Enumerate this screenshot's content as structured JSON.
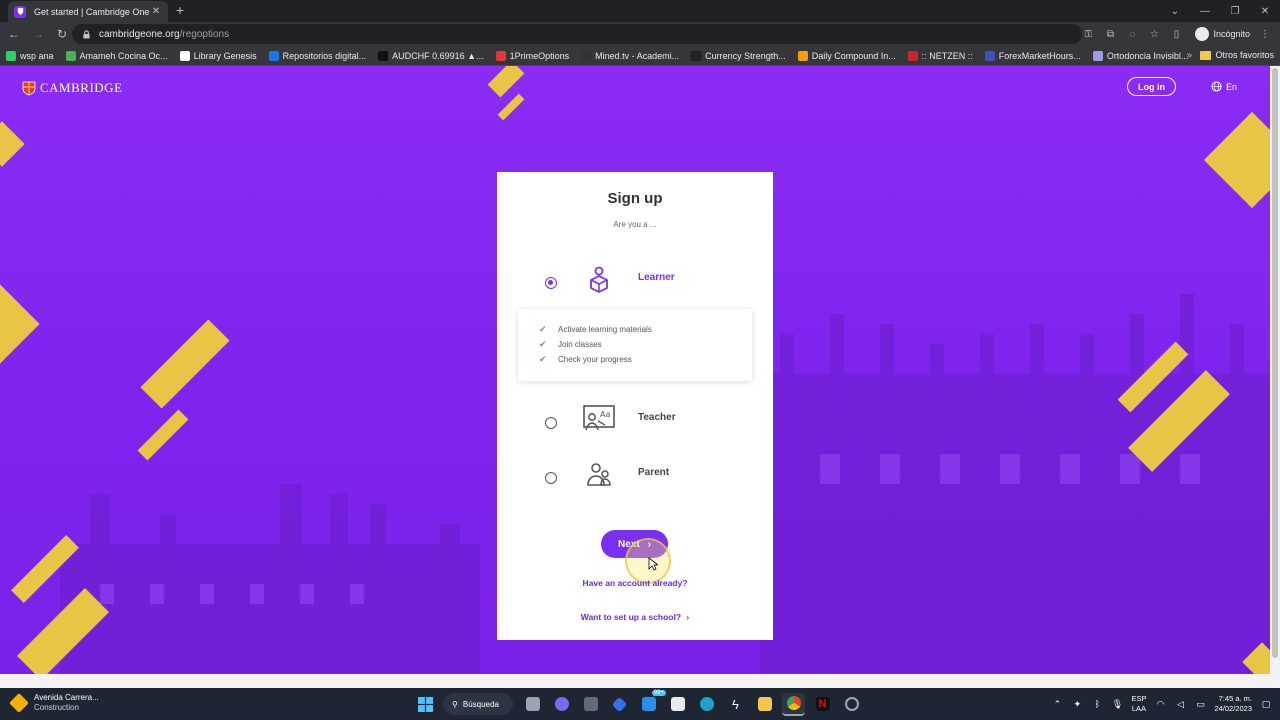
{
  "browser": {
    "tab_title": "Get started | Cambridge One",
    "new_tab": "+",
    "url_host": "cambridgeone.org",
    "url_path": "/regoptions",
    "incognito_label": "Incógnito",
    "bookmarks": [
      {
        "label": "wsp ana",
        "color": "#25d366"
      },
      {
        "label": "Amameh Cocina Oc...",
        "color": "#4caf50"
      },
      {
        "label": "Library Genesis",
        "color": "#ffffff"
      },
      {
        "label": "Repositorios digital...",
        "color": "#1a73e8"
      },
      {
        "label": "AUDCHF 0.69916 ▲...",
        "color": "#111111"
      },
      {
        "label": "1PrimeOptions",
        "color": "#e53935"
      },
      {
        "label": "Mined.tv - Academi...",
        "color": "#333333"
      },
      {
        "label": "Currency Strength...",
        "color": "#222222"
      },
      {
        "label": "Daily Compound In...",
        "color": "#f59e0b"
      },
      {
        "label": ":: NETZEN ::",
        "color": "#c62828"
      },
      {
        "label": "ForexMarketHours...",
        "color": "#3f51b5"
      },
      {
        "label": "Ortodoncia Invisibl...",
        "color": "#9c9ce8"
      }
    ],
    "other_bookmarks": "Otros favoritos"
  },
  "header": {
    "logo_text": "CAMBRIDGE",
    "login_label": "Log in",
    "language_label": "En"
  },
  "signup": {
    "title": "Sign up",
    "subtitle": "Are you a ...",
    "roles": [
      {
        "label": "Learner",
        "selected": true
      },
      {
        "label": "Teacher",
        "selected": false
      },
      {
        "label": "Parent",
        "selected": false
      }
    ],
    "learner_benefits": [
      "Activate learning materials",
      "Join classes",
      "Check your progress"
    ],
    "next_label": "Next",
    "next_chevron": "›",
    "have_account_label": "Have an account already?",
    "setup_school_label": "Want to set up a school?",
    "setup_chevron": "›"
  },
  "colors": {
    "brand_purple": "#7b2ff2",
    "accent_yellow": "#e8c545",
    "check_green": "#5aa86a"
  },
  "taskbar": {
    "weather_title": "Avenida Carrera...",
    "weather_sub": "Construction",
    "search_label": "Búsqueda",
    "notification_badge": "99+",
    "lang_top": "ESP",
    "lang_bottom": "LAA",
    "time": "7:45 a. m.",
    "date": "24/02/2023"
  }
}
